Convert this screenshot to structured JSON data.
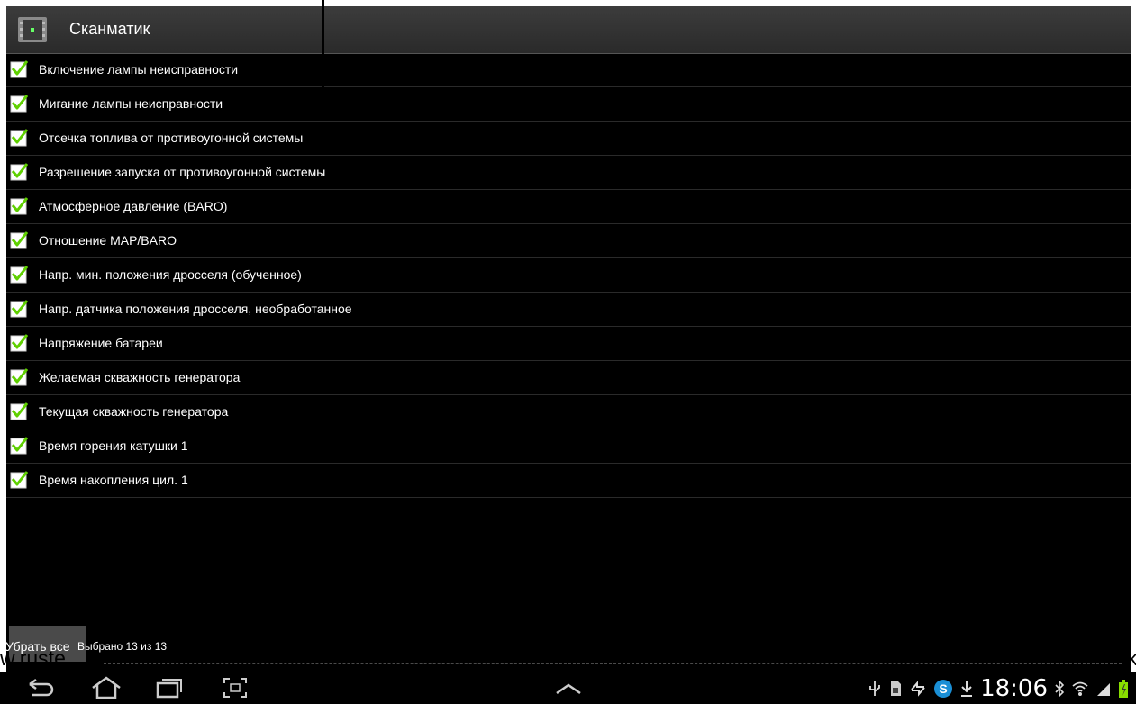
{
  "app": {
    "title": "Сканматик"
  },
  "items": [
    {
      "label": "Включение лампы неисправности",
      "checked": true
    },
    {
      "label": "Мигание лампы неисправности",
      "checked": true
    },
    {
      "label": "Отсечка топлива от противоугонной системы",
      "checked": true
    },
    {
      "label": "Разрешение запуска от противоугонной системы",
      "checked": true
    },
    {
      "label": "Атмосферное давление (BARO)",
      "checked": true
    },
    {
      "label": "Отношение MAP/BARO",
      "checked": true
    },
    {
      "label": "Напр. мин. положения дросселя (обученное)",
      "checked": true
    },
    {
      "label": "Напр. датчика положения дросселя, необработанное",
      "checked": true
    },
    {
      "label": "Напряжение батареи",
      "checked": true
    },
    {
      "label": "Желаемая скважность генератора",
      "checked": true
    },
    {
      "label": "Текущая скважность генератора",
      "checked": true
    },
    {
      "label": "Время горения катушки 1",
      "checked": true
    },
    {
      "label": "Время накопления цил. 1",
      "checked": true
    }
  ],
  "footer": {
    "clear_label": "Убрать все",
    "selected_text": "Выбрано 13 из 13"
  },
  "overlay": {
    "left_text": "w.ruste",
    "right_text": "k"
  },
  "status": {
    "time": "18:06"
  },
  "colors": {
    "check_green": "#5fd000",
    "actionbar": "#333333",
    "background": "#000000"
  },
  "icons": [
    "back-icon",
    "home-icon",
    "recent-apps-icon",
    "screenshot-icon",
    "up-chevron-icon",
    "usb-icon",
    "sd-card-icon",
    "sync-icon",
    "skype-icon",
    "download-icon",
    "bluetooth-icon",
    "wifi-icon",
    "signal-icon",
    "battery-icon"
  ]
}
